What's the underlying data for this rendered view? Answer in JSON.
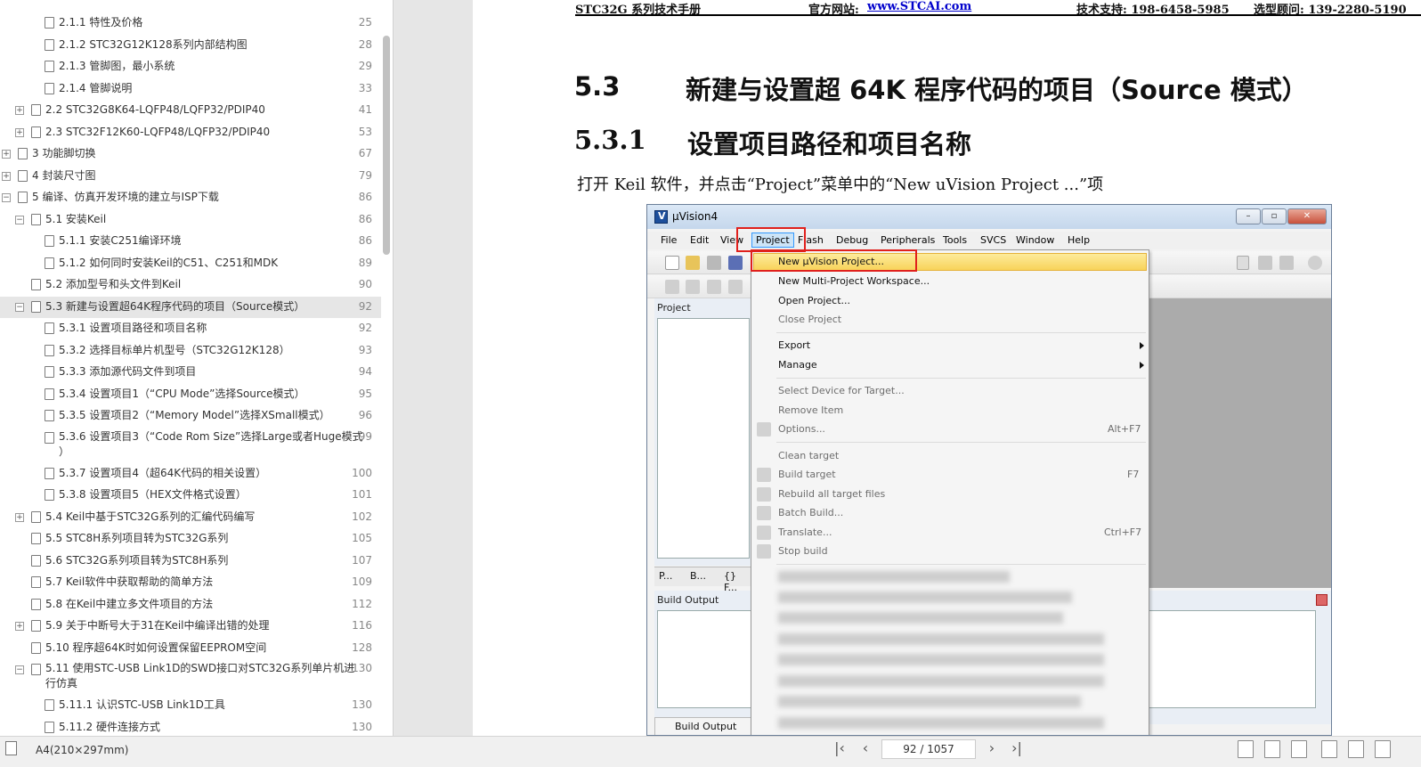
{
  "sidebar": {
    "toc": [
      {
        "label": "2.1.1 特性及价格",
        "page": "25",
        "level": 3,
        "expander": ""
      },
      {
        "label": "2.1.2 STC32G12K128系列内部结构图",
        "page": "28",
        "level": 3,
        "expander": ""
      },
      {
        "label": "2.1.3 管脚图，最小系统",
        "page": "29",
        "level": 3,
        "expander": ""
      },
      {
        "label": "2.1.4 管脚说明",
        "page": "33",
        "level": 3,
        "expander": ""
      },
      {
        "label": "2.2 STC32G8K64-LQFP48/LQFP32/PDIP40",
        "page": "41",
        "level": 2,
        "expander": "+"
      },
      {
        "label": "2.3 STC32F12K60-LQFP48/LQFP32/PDIP40",
        "page": "53",
        "level": 2,
        "expander": "+"
      },
      {
        "label": "3 功能脚切换",
        "page": "67",
        "level": 1,
        "expander": "+"
      },
      {
        "label": "4 封装尺寸图",
        "page": "79",
        "level": 1,
        "expander": "+"
      },
      {
        "label": "5 编译、仿真开发环境的建立与ISP下载",
        "page": "86",
        "level": 1,
        "expander": "−"
      },
      {
        "label": "5.1 安装Keil",
        "page": "86",
        "level": 2,
        "expander": "−"
      },
      {
        "label": "5.1.1 安装C251编译环境",
        "page": "86",
        "level": 3,
        "expander": ""
      },
      {
        "label": "5.1.2 如何同时安装Keil的C51、C251和MDK",
        "page": "89",
        "level": 3,
        "expander": ""
      },
      {
        "label": "5.2 添加型号和头文件到Keil",
        "page": "90",
        "level": 2,
        "expander": ""
      },
      {
        "label": "5.3 新建与设置超64K程序代码的项目（Source模式）",
        "page": "92",
        "level": 2,
        "expander": "−",
        "selected": true
      },
      {
        "label": "5.3.1 设置项目路径和项目名称",
        "page": "92",
        "level": 3,
        "expander": ""
      },
      {
        "label": "5.3.2 选择目标单片机型号（STC32G12K128）",
        "page": "93",
        "level": 3,
        "expander": ""
      },
      {
        "label": "5.3.3 添加源代码文件到项目",
        "page": "94",
        "level": 3,
        "expander": ""
      },
      {
        "label": "5.3.4 设置项目1（“CPU Mode”选择Source模式）",
        "page": "95",
        "level": 3,
        "expander": ""
      },
      {
        "label": "5.3.5 设置项目2（“Memory Model”选择XSmall模式）",
        "page": "96",
        "level": 3,
        "expander": ""
      },
      {
        "label": "5.3.6 设置项目3（“Code Rom Size”选择Large或者Huge模式",
        "label2": "）",
        "page": "99",
        "level": 3,
        "expander": ""
      },
      {
        "label": "5.3.7 设置项目4（超64K代码的相关设置）",
        "page": "100",
        "level": 3,
        "expander": ""
      },
      {
        "label": "5.3.8 设置项目5（HEX文件格式设置）",
        "page": "101",
        "level": 3,
        "expander": ""
      },
      {
        "label": "5.4 Keil中基于STC32G系列的汇编代码编写",
        "page": "102",
        "level": 2,
        "expander": "+"
      },
      {
        "label": "5.5 STC8H系列项目转为STC32G系列",
        "page": "105",
        "level": 2,
        "expander": ""
      },
      {
        "label": "5.6 STC32G系列项目转为STC8H系列",
        "page": "107",
        "level": 2,
        "expander": ""
      },
      {
        "label": "5.7 Keil软件中获取帮助的简单方法",
        "page": "109",
        "level": 2,
        "expander": ""
      },
      {
        "label": "5.8 在Keil中建立多文件项目的方法",
        "page": "112",
        "level": 2,
        "expander": ""
      },
      {
        "label": "5.9 关于中断号大于31在Keil中编译出错的处理",
        "page": "116",
        "level": 2,
        "expander": "+"
      },
      {
        "label": "5.10 程序超64K时如何设置保留EEPROM空间",
        "page": "128",
        "level": 2,
        "expander": ""
      },
      {
        "label": "5.11 使用STC-USB Link1D的SWD接口对STC32G系列单片机进",
        "label2": "行仿真",
        "page": "130",
        "level": 2,
        "expander": "−"
      },
      {
        "label": "5.11.1 认识STC-USB Link1D工具",
        "page": "130",
        "level": 3,
        "expander": ""
      },
      {
        "label": "5.11.2 硬件连接方式",
        "page": "130",
        "level": 3,
        "expander": ""
      }
    ]
  },
  "doc": {
    "header": {
      "manual": "STC32G 系列技术手册",
      "site_label": "官方网站: ",
      "site_link": "www.STCAI.com",
      "support": "技术支持: 198-6458-5985",
      "advisor": "选型顾问: 139-2280-5190"
    },
    "h2_num": "5.3",
    "h2_text": "新建与设置超 64K 程序代码的项目（Source 模式）",
    "h3_num": "5.3.1",
    "h3_text": "设置项目路径和项目名称",
    "paragraph": "打开 Keil 软件，并点击“Project”菜单中的“New uVision Project ...”项"
  },
  "uvision": {
    "title": "µVision4",
    "menus": [
      "File",
      "Edit",
      "View",
      "Project",
      "Flash",
      "Debug",
      "Peripherals",
      "Tools",
      "SVCS",
      "Window",
      "Help"
    ],
    "project_pane_label": "Project",
    "tabs": [
      "P...",
      "B...",
      "{} F..."
    ],
    "build_output_label": "Build Output",
    "bottom_tab": "Build Output",
    "dropdown": [
      {
        "label": "New µVision Project...",
        "shortcut": "",
        "enabled": true,
        "highlighted": true
      },
      {
        "label": "New Multi-Project Workspace...",
        "shortcut": "",
        "enabled": true
      },
      {
        "label": "Open Project...",
        "shortcut": "",
        "enabled": true
      },
      {
        "label": "Close Project",
        "shortcut": "",
        "enabled": false
      },
      {
        "label": "Export",
        "shortcut": "",
        "enabled": true,
        "submenu": true
      },
      {
        "label": "Manage",
        "shortcut": "",
        "enabled": true,
        "submenu": true
      },
      {
        "label": "Select Device for Target...",
        "shortcut": "",
        "enabled": false
      },
      {
        "label": "Remove Item",
        "shortcut": "",
        "enabled": false
      },
      {
        "label": "Options...",
        "shortcut": "Alt+F7",
        "enabled": false
      },
      {
        "label": "Clean target",
        "shortcut": "",
        "enabled": false
      },
      {
        "label": "Build target",
        "shortcut": "F7",
        "enabled": false
      },
      {
        "label": "Rebuild all target files",
        "shortcut": "",
        "enabled": false
      },
      {
        "label": "Batch Build...",
        "shortcut": "",
        "enabled": false
      },
      {
        "label": "Translate...",
        "shortcut": "Ctrl+F7",
        "enabled": false
      },
      {
        "label": "Stop build",
        "shortcut": "",
        "enabled": false
      }
    ]
  },
  "statusbar": {
    "page_size": "A4(210×297mm)",
    "page_indicator": "92 / 1057"
  }
}
